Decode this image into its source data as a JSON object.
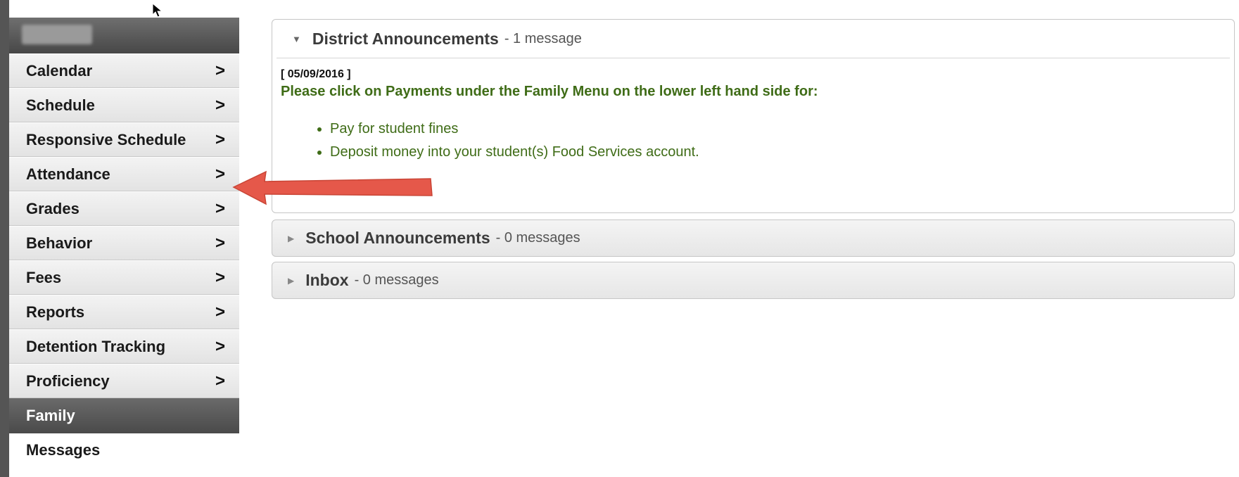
{
  "sidebar": {
    "nav_items": [
      {
        "label": "Calendar",
        "chevron": ">"
      },
      {
        "label": "Schedule",
        "chevron": ">"
      },
      {
        "label": "Responsive Schedule",
        "chevron": ">"
      },
      {
        "label": "Attendance",
        "chevron": ">"
      },
      {
        "label": "Grades",
        "chevron": ">"
      },
      {
        "label": "Behavior",
        "chevron": ">"
      },
      {
        "label": "Fees",
        "chevron": ">"
      },
      {
        "label": "Reports",
        "chevron": ">"
      },
      {
        "label": "Detention Tracking",
        "chevron": ">"
      },
      {
        "label": "Proficiency",
        "chevron": ">"
      }
    ],
    "family_section": {
      "label": "Family"
    },
    "family_items": [
      {
        "label": "Messages"
      }
    ]
  },
  "main": {
    "district": {
      "title": "District Announcements",
      "count": "- 1 message",
      "date": "[ 05/09/2016 ]",
      "text": "Please click on Payments under the Family Menu on the lower left hand side for:",
      "bullets": [
        "Pay for student fines",
        "Deposit money into your student(s) Food Services account."
      ]
    },
    "school": {
      "title": "School Announcements",
      "count": "- 0 messages"
    },
    "inbox": {
      "title": "Inbox",
      "count": "- 0 messages"
    }
  },
  "colors": {
    "announcement_text": "#3f6c17",
    "annotation_arrow": "#e5584a",
    "sidebar_header": "#555555"
  },
  "icons": {
    "expanded": "triangle-down-icon",
    "collapsed": "triangle-right-icon",
    "nav": "chevron-right-icon",
    "annotation": "red-arrow-icon",
    "pointer": "mouse-cursor-icon"
  }
}
